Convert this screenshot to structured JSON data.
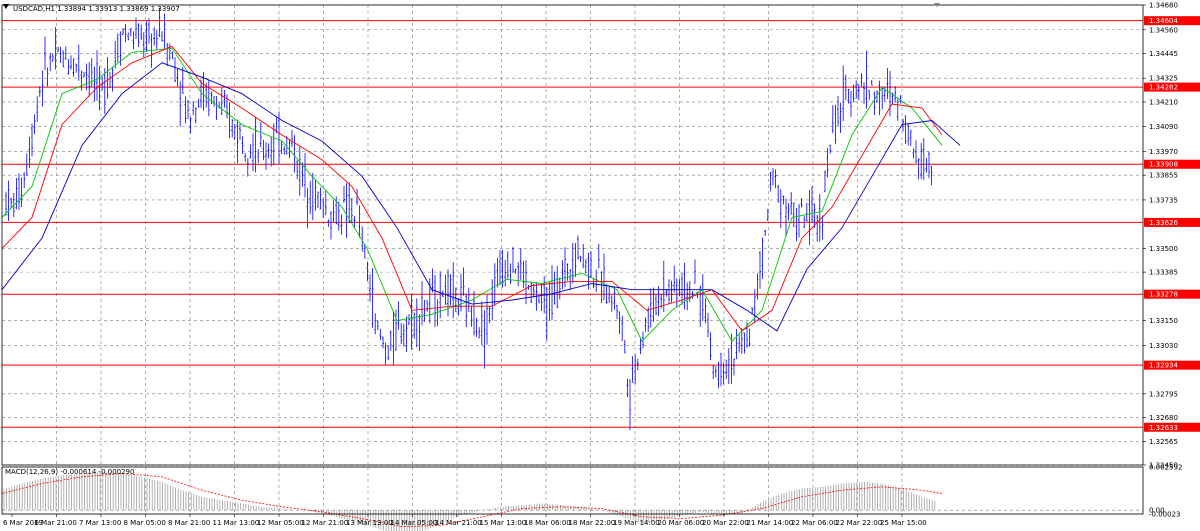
{
  "window": {
    "title": "USDCAD,H1  1.33894 1.33913 1.33869 1.33907"
  },
  "colors": {
    "candle": "#0000ff",
    "level": "#ff0000",
    "ma_fast": "#00c800",
    "ma_mid": "#ff0000",
    "ma_slow": "#0000cc",
    "macd_hist": "#a0a0a0",
    "macd_signal": "#ff0000",
    "grid": "#808080"
  },
  "chart_data": [
    {
      "type": "line",
      "title": "USDCAD,H1  1.33894 1.33913 1.33869 1.33907",
      "ylim": [
        1.3245,
        1.3468
      ],
      "grid": true,
      "price_ticks": [
        "1.34680",
        "1.34560",
        "1.34445",
        "1.34325",
        "1.34210",
        "1.34090",
        "1.33970",
        "1.33855",
        "1.33735",
        "1.33500",
        "1.33385",
        "1.33150",
        "1.33030",
        "1.32795",
        "1.32680",
        "1.32565",
        "1.32450"
      ],
      "levels": [
        {
          "value": 1.34604,
          "label": "1.34604"
        },
        {
          "value": 1.34282,
          "label": "1.34282"
        },
        {
          "value": 1.33908,
          "label": "1.33908"
        },
        {
          "value": 1.33626,
          "label": "1.33626"
        },
        {
          "value": 1.33278,
          "label": "1.33278"
        },
        {
          "value": 1.32934,
          "label": "1.32934"
        },
        {
          "value": 1.32633,
          "label": "1.32633"
        }
      ],
      "time_labels": [
        "6 Mar 2019",
        "6 Mar 21:00",
        "7 Mar 13:00",
        "8 Mar 05:00",
        "8 Mar 21:00",
        "11 Mar 13:00",
        "12 Mar 05:00",
        "12 Mar 21:00",
        "13 Mar 13:00",
        "14 Mar 05:00",
        "14 Mar 21:00",
        "15 Mar 13:00",
        "18 Mar 06:00",
        "18 Mar 22:00",
        "19 Mar 14:00",
        "20 Mar 06:00",
        "20 Mar 22:00",
        "21 Mar 14:00",
        "22 Mar 06:00",
        "22 Mar 22:00",
        "25 Mar 15:00"
      ],
      "series_path": [
        [
          0,
          1.3378
        ],
        [
          10,
          1.337
        ],
        [
          20,
          1.338
        ],
        [
          28,
          1.34
        ],
        [
          40,
          1.3433
        ],
        [
          52,
          1.3443
        ],
        [
          70,
          1.3441
        ],
        [
          85,
          1.3436
        ],
        [
          100,
          1.3426
        ],
        [
          110,
          1.3437
        ],
        [
          120,
          1.3455
        ],
        [
          135,
          1.3452
        ],
        [
          150,
          1.345
        ],
        [
          160,
          1.3456
        ],
        [
          175,
          1.3436
        ],
        [
          185,
          1.3415
        ],
        [
          200,
          1.3425
        ],
        [
          215,
          1.342
        ],
        [
          230,
          1.341
        ],
        [
          245,
          1.3402
        ],
        [
          260,
          1.3396
        ],
        [
          275,
          1.3403
        ],
        [
          290,
          1.34
        ],
        [
          300,
          1.3385
        ],
        [
          310,
          1.3378
        ],
        [
          320,
          1.3372
        ],
        [
          330,
          1.3365
        ],
        [
          340,
          1.3368
        ],
        [
          355,
          1.3368
        ],
        [
          365,
          1.334
        ],
        [
          375,
          1.331
        ],
        [
          385,
          1.33
        ],
        [
          395,
          1.331
        ],
        [
          410,
          1.3315
        ],
        [
          425,
          1.3322
        ],
        [
          440,
          1.333
        ],
        [
          455,
          1.3326
        ],
        [
          470,
          1.332
        ],
        [
          482,
          1.331
        ],
        [
          495,
          1.3335
        ],
        [
          505,
          1.3345
        ],
        [
          518,
          1.334
        ],
        [
          530,
          1.3328
        ],
        [
          545,
          1.3322
        ],
        [
          560,
          1.3335
        ],
        [
          575,
          1.335
        ],
        [
          590,
          1.334
        ],
        [
          605,
          1.333
        ],
        [
          618,
          1.332
        ],
        [
          628,
          1.328
        ],
        [
          636,
          1.33
        ],
        [
          645,
          1.3315
        ],
        [
          660,
          1.333
        ],
        [
          675,
          1.3332
        ],
        [
          690,
          1.333
        ],
        [
          702,
          1.3325
        ],
        [
          712,
          1.329
        ],
        [
          722,
          1.3295
        ],
        [
          735,
          1.3298
        ],
        [
          748,
          1.331
        ],
        [
          760,
          1.3345
        ],
        [
          770,
          1.3385
        ],
        [
          780,
          1.3375
        ],
        [
          792,
          1.3365
        ],
        [
          805,
          1.3365
        ],
        [
          818,
          1.3362
        ],
        [
          828,
          1.34
        ],
        [
          840,
          1.342
        ],
        [
          852,
          1.3428
        ],
        [
          865,
          1.343
        ],
        [
          878,
          1.3422
        ],
        [
          890,
          1.3425
        ],
        [
          900,
          1.3418
        ],
        [
          910,
          1.34
        ],
        [
          922,
          1.3392
        ],
        [
          932,
          1.3391
        ]
      ],
      "moving_averages": [
        {
          "color": "#00c800",
          "values": [
            [
              0,
              1.3365
            ],
            [
              30,
              1.338
            ],
            [
              60,
              1.3425
            ],
            [
              95,
              1.3432
            ],
            [
              130,
              1.3445
            ],
            [
              170,
              1.3447
            ],
            [
              200,
              1.3425
            ],
            [
              240,
              1.341
            ],
            [
              280,
              1.3402
            ],
            [
              310,
              1.3385
            ],
            [
              340,
              1.337
            ],
            [
              365,
              1.335
            ],
            [
              395,
              1.3315
            ],
            [
              430,
              1.3318
            ],
            [
              470,
              1.3325
            ],
            [
              505,
              1.3335
            ],
            [
              540,
              1.3333
            ],
            [
              580,
              1.3338
            ],
            [
              615,
              1.333
            ],
            [
              640,
              1.3305
            ],
            [
              670,
              1.332
            ],
            [
              700,
              1.333
            ],
            [
              730,
              1.3305
            ],
            [
              760,
              1.332
            ],
            [
              790,
              1.3365
            ],
            [
              820,
              1.3368
            ],
            [
              850,
              1.3405
            ],
            [
              880,
              1.3428
            ],
            [
              910,
              1.3418
            ],
            [
              940,
              1.34
            ]
          ]
        },
        {
          "color": "#ff0000",
          "values": [
            [
              0,
              1.335
            ],
            [
              30,
              1.3365
            ],
            [
              60,
              1.341
            ],
            [
              95,
              1.3428
            ],
            [
              130,
              1.344
            ],
            [
              170,
              1.3448
            ],
            [
              200,
              1.343
            ],
            [
              240,
              1.3418
            ],
            [
              280,
              1.3405
            ],
            [
              320,
              1.3393
            ],
            [
              350,
              1.338
            ],
            [
              380,
              1.3355
            ],
            [
              410,
              1.332
            ],
            [
              450,
              1.3322
            ],
            [
              490,
              1.3322
            ],
            [
              530,
              1.3332
            ],
            [
              570,
              1.3334
            ],
            [
              610,
              1.3334
            ],
            [
              645,
              1.332
            ],
            [
              680,
              1.3325
            ],
            [
              710,
              1.333
            ],
            [
              740,
              1.331
            ],
            [
              770,
              1.332
            ],
            [
              800,
              1.3355
            ],
            [
              830,
              1.337
            ],
            [
              860,
              1.3395
            ],
            [
              890,
              1.342
            ],
            [
              920,
              1.3418
            ],
            [
              940,
              1.3405
            ]
          ]
        },
        {
          "color": "#0000cc",
          "values": [
            [
              0,
              1.333
            ],
            [
              40,
              1.3355
            ],
            [
              80,
              1.34
            ],
            [
              120,
              1.3425
            ],
            [
              160,
              1.344
            ],
            [
              200,
              1.3433
            ],
            [
              240,
              1.3425
            ],
            [
              280,
              1.3412
            ],
            [
              320,
              1.3402
            ],
            [
              360,
              1.3385
            ],
            [
              395,
              1.336
            ],
            [
              430,
              1.333
            ],
            [
              470,
              1.3323
            ],
            [
              510,
              1.3325
            ],
            [
              550,
              1.3328
            ],
            [
              590,
              1.3333
            ],
            [
              630,
              1.333
            ],
            [
              670,
              1.333
            ],
            [
              710,
              1.333
            ],
            [
              745,
              1.332
            ],
            [
              775,
              1.331
            ],
            [
              805,
              1.334
            ],
            [
              840,
              1.336
            ],
            [
              870,
              1.3385
            ],
            [
              900,
              1.341
            ],
            [
              930,
              1.3412
            ],
            [
              958,
              1.34
            ]
          ]
        }
      ]
    },
    {
      "type": "bar",
      "title": "MACD(12,26,9) -0.000614 -0.000290",
      "ylim": [
        -0.00023,
        0.00259
      ],
      "tick_labels": [
        "0.002592",
        "0.00",
        "-0.00023"
      ],
      "histogram": [
        [
          0,
          0.0012
        ],
        [
          20,
          0.0016
        ],
        [
          40,
          0.0019
        ],
        [
          60,
          0.0021
        ],
        [
          80,
          0.0022
        ],
        [
          100,
          0.0023
        ],
        [
          120,
          0.0022
        ],
        [
          140,
          0.002
        ],
        [
          160,
          0.0017
        ],
        [
          180,
          0.0012
        ],
        [
          200,
          0.0008
        ],
        [
          220,
          0.0006
        ],
        [
          240,
          0.0004
        ],
        [
          260,
          0.0002
        ],
        [
          280,
          0.0001
        ],
        [
          300,
          0.0
        ],
        [
          320,
          -0.0002
        ],
        [
          340,
          -0.0005
        ],
        [
          360,
          -0.0008
        ],
        [
          380,
          -0.0012
        ],
        [
          400,
          -0.0015
        ],
        [
          420,
          -0.0013
        ],
        [
          440,
          -0.0008
        ],
        [
          460,
          -0.0003
        ],
        [
          480,
          0.0
        ],
        [
          500,
          0.0002
        ],
        [
          520,
          0.0003
        ],
        [
          540,
          0.0004
        ],
        [
          560,
          0.0003
        ],
        [
          580,
          0.0002
        ],
        [
          600,
          0.0
        ],
        [
          620,
          -0.0004
        ],
        [
          640,
          -0.0008
        ],
        [
          660,
          -0.0006
        ],
        [
          680,
          -0.0003
        ],
        [
          700,
          -0.0001
        ],
        [
          720,
          -0.0003
        ],
        [
          740,
          -0.0002
        ],
        [
          760,
          0.0005
        ],
        [
          780,
          0.001
        ],
        [
          800,
          0.0013
        ],
        [
          820,
          0.0014
        ],
        [
          840,
          0.0016
        ],
        [
          860,
          0.0017
        ],
        [
          880,
          0.0016
        ],
        [
          900,
          0.0013
        ],
        [
          920,
          0.0008
        ],
        [
          935,
          0.0005
        ]
      ],
      "signal": [
        [
          0,
          0.001
        ],
        [
          40,
          0.0016
        ],
        [
          80,
          0.002
        ],
        [
          120,
          0.0022
        ],
        [
          160,
          0.002
        ],
        [
          200,
          0.0012
        ],
        [
          240,
          0.0006
        ],
        [
          280,
          0.0002
        ],
        [
          320,
          -0.0001
        ],
        [
          360,
          -0.0005
        ],
        [
          400,
          -0.001
        ],
        [
          440,
          -0.0009
        ],
        [
          480,
          -0.0004
        ],
        [
          520,
          0.0001
        ],
        [
          560,
          0.0002
        ],
        [
          600,
          0.0001
        ],
        [
          640,
          -0.0004
        ],
        [
          680,
          -0.0005
        ],
        [
          720,
          -0.0003
        ],
        [
          760,
          0.0001
        ],
        [
          800,
          0.0008
        ],
        [
          840,
          0.0012
        ],
        [
          880,
          0.0014
        ],
        [
          920,
          0.0012
        ],
        [
          940,
          0.001
        ]
      ]
    }
  ]
}
